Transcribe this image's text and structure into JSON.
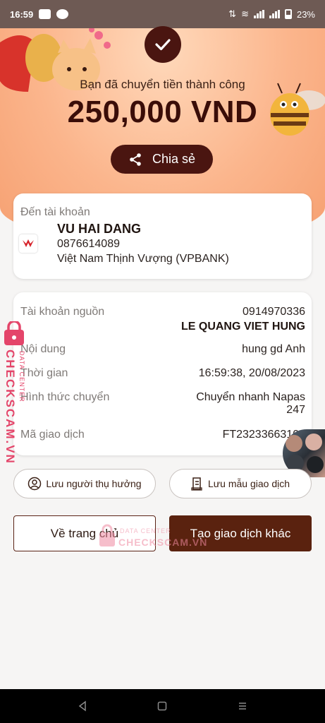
{
  "status_bar": {
    "time": "16:59",
    "battery": "23%"
  },
  "receipt": {
    "success_message": "Bạn đã chuyển tiền thành công",
    "amount": "250,000 VND",
    "share_label": "Chia sẻ"
  },
  "recipient": {
    "label": "Đến tài khoản",
    "name": "VU HAI DANG",
    "account": "0876614089",
    "bank": "Việt Nam Thịnh Vượng (VPBANK)"
  },
  "details": {
    "source_label": "Tài khoản nguồn",
    "source_account": "0914970336",
    "source_name": "LE QUANG VIET HUNG",
    "content_label": "Nội dung",
    "content_value": "hung gd Anh",
    "time_label": "Thời gian",
    "time_value": "16:59:38, 20/08/2023",
    "method_label": "Hình thức chuyển",
    "method_value_line1": "Chuyển nhanh Napas",
    "method_value_line2": "247",
    "txn_label": "Mã giao dịch",
    "txn_value": "FT23233663100"
  },
  "actions": {
    "save_beneficiary": "Lưu người thụ hưởng",
    "save_template": "Lưu mẫu giao dịch",
    "home": "Về trang chủ",
    "new_transaction": "Tạo giao dịch khác"
  },
  "watermark": {
    "brand": "CHECKSCAM.VN",
    "sub": "DATA CENTER"
  },
  "colors": {
    "primary": "#4a1510",
    "hero": "#f8b08a",
    "watermark": "#e4456a"
  }
}
